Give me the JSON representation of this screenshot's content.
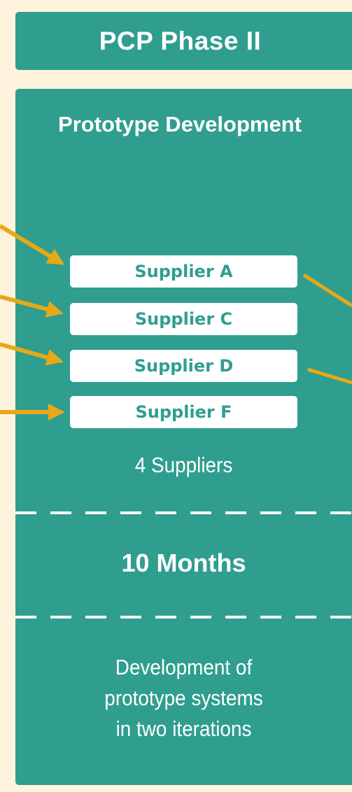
{
  "header": {
    "title": "PCP Phase II"
  },
  "phase": {
    "title": "Prototype Development",
    "suppliers": [
      "Supplier A",
      "Supplier C",
      "Supplier D",
      "Supplier F"
    ],
    "count_label": "4 Suppliers",
    "duration": "10 Months",
    "description_lines": [
      "Development of",
      "prototype systems",
      "in two iterations"
    ]
  },
  "colors": {
    "background": "#fef4de",
    "panel": "#2f9e8f",
    "arrow": "#e8a917",
    "text_on_panel": "#ffffff"
  }
}
